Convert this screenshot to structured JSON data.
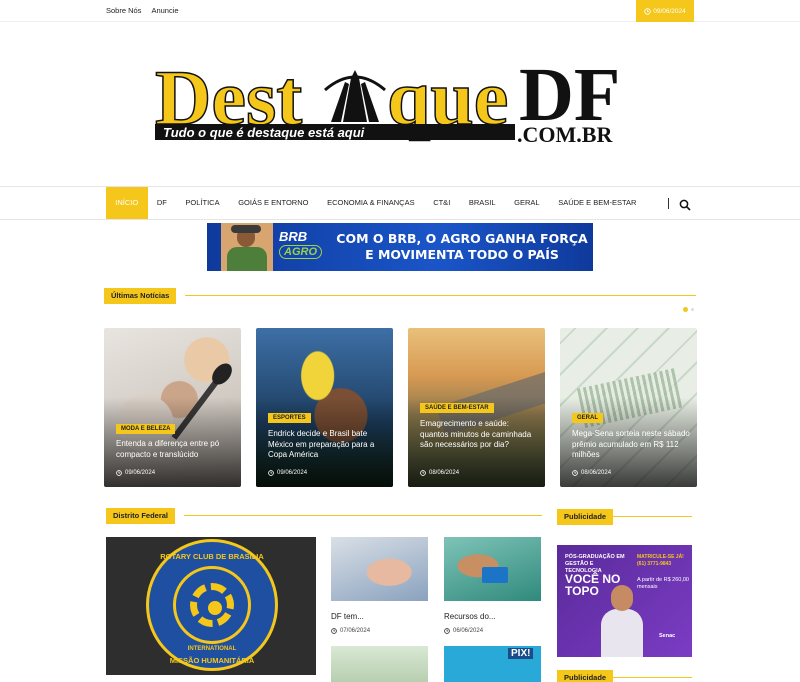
{
  "topbar": {
    "links": [
      "Sobre Nós",
      "Anuncie"
    ],
    "date": "09/06/2024"
  },
  "logo": {
    "text_dest": "Dest",
    "text_que": "que",
    "text_df": "DF",
    "tagline": "Tudo o que é destaque está aqui",
    "domain": ".COM.BR"
  },
  "nav": {
    "items": [
      "INÍCIO",
      "DF",
      "POLÍTICA",
      "GOIÁS E ENTORNO",
      "ECONOMIA & FINANÇAS",
      "CT&I",
      "BRASIL",
      "GERAL",
      "SAÚDE E BEM-ESTAR"
    ]
  },
  "banner": {
    "brand_top": "BRB",
    "brand_bottom": "AGRO",
    "line1": "COM O BRB, O AGRO GANHA FORÇA",
    "line2": "E MOVIMENTA TODO O PAÍS"
  },
  "latest": {
    "heading": "Últimas Notícias",
    "cards": [
      {
        "category": "MODA E BELEZA",
        "title": "Entenda a diferença entre pó compacto e translúcido",
        "date": "09/06/2024"
      },
      {
        "category": "ESPORTES",
        "title": "Endrick decide e Brasil bate México em preparação para a Copa América",
        "date": "09/06/2024"
      },
      {
        "category": "SAÚDE E BEM-ESTAR",
        "title": "Emagrecimento e saúde: quantos minutos de caminhada são necessários por dia?",
        "date": "08/06/2024"
      },
      {
        "category": "GERAL",
        "title": "Mega-Sena sorteia neste sábado prêmio acumulado em R$ 112 milhões",
        "date": "08/06/2024"
      }
    ]
  },
  "df_section": {
    "heading": "Distrito Federal",
    "feature_image_text_top": "ROTARY CLUB DE BRASÍLIA",
    "feature_image_text_bottom": "MISSÃO HUMANITÁRIA",
    "feature_image_ring": "ROTARY",
    "feature_image_ring_bottom": "INTERNATIONAL",
    "small": [
      {
        "title": "DF tem...",
        "date": "07/06/2024"
      },
      {
        "title": "Recursos do...",
        "date": "06/06/2024"
      }
    ],
    "pix_label": "PIX!"
  },
  "sidebar": {
    "heading": "Publicidade",
    "heading2": "Publicidade",
    "ad": {
      "line1": "PÓS-GRADUAÇÃO EM GESTÃO E TECNOLOGIA",
      "line2": "MATRICULE-SE JÁ! (61) 3771-9843",
      "headline": "VOCÊ NO TOPO",
      "price": "A partir de R$ 260,00 mensais",
      "brand": "Senac"
    }
  },
  "colors": {
    "accent": "#f5c71a",
    "banner_blue": "#1a55c8"
  }
}
